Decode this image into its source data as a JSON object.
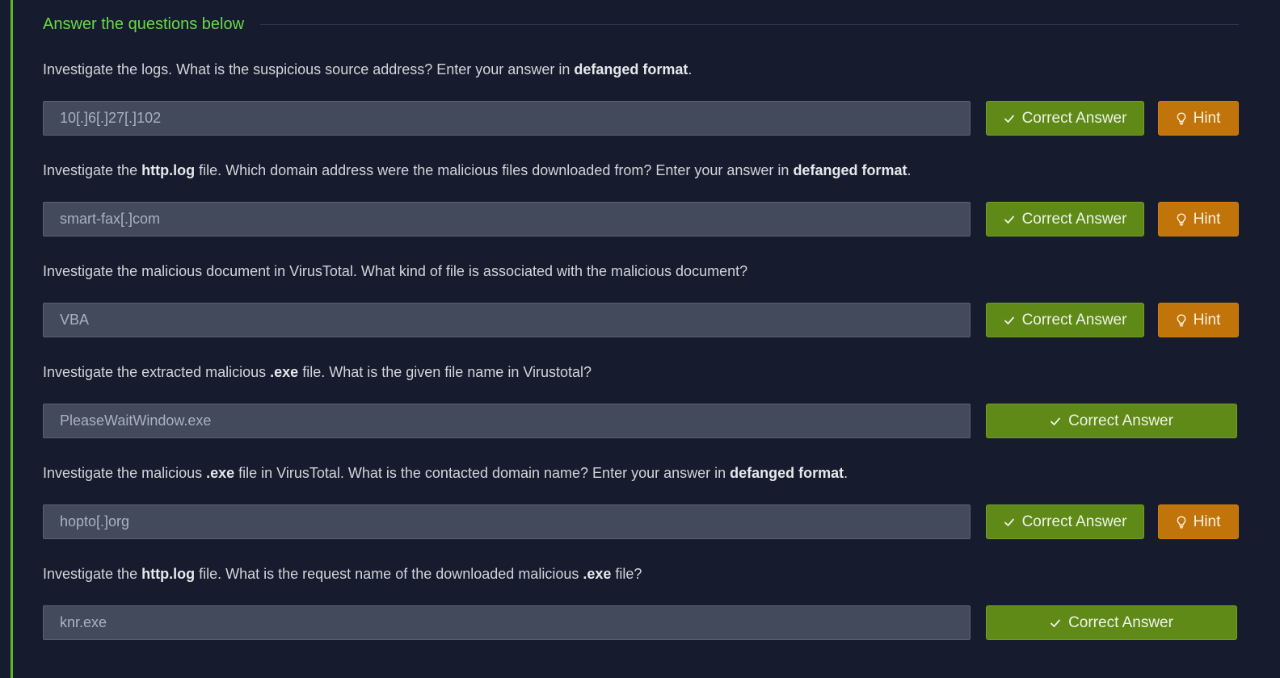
{
  "section": {
    "title": "Answer the questions below"
  },
  "questions": [
    {
      "parts": [
        {
          "text": "Investigate the logs. What is the suspicious source address? Enter your answer in ",
          "bold": false
        },
        {
          "text": "defanged format",
          "bold": true
        },
        {
          "text": ".",
          "bold": false
        }
      ],
      "answer": "10[.]6[.]27[.]102",
      "correct_label": "Correct Answer",
      "hint_label": "Hint"
    },
    {
      "parts": [
        {
          "text": "Investigate the ",
          "bold": false
        },
        {
          "text": "http.log",
          "bold": true
        },
        {
          "text": " file. Which domain address were the malicious files downloaded from? Enter your answer in ",
          "bold": false
        },
        {
          "text": "defanged format",
          "bold": true
        },
        {
          "text": ".",
          "bold": false
        }
      ],
      "answer": "smart-fax[.]com",
      "correct_label": "Correct Answer",
      "hint_label": "Hint"
    },
    {
      "parts": [
        {
          "text": "Investigate the malicious document in VirusTotal. What kind of file is associated with the malicious document?",
          "bold": false
        }
      ],
      "answer": "VBA",
      "correct_label": "Correct Answer",
      "hint_label": "Hint"
    },
    {
      "parts": [
        {
          "text": "Investigate the extracted malicious ",
          "bold": false
        },
        {
          "text": ".exe",
          "bold": true
        },
        {
          "text": " file. What is the given file name in Virustotal?",
          "bold": false
        }
      ],
      "answer": "PleaseWaitWindow.exe",
      "correct_label": "Correct Answer",
      "hint_label": ""
    },
    {
      "parts": [
        {
          "text": "Investigate the malicious ",
          "bold": false
        },
        {
          "text": ".exe",
          "bold": true
        },
        {
          "text": " file in VirusTotal. What is the contacted domain name? Enter your answer in ",
          "bold": false
        },
        {
          "text": "defanged format",
          "bold": true
        },
        {
          "text": ".",
          "bold": false
        }
      ],
      "answer": "hopto[.]org",
      "correct_label": "Correct Answer",
      "hint_label": "Hint"
    },
    {
      "parts": [
        {
          "text": "Investigate the ",
          "bold": false
        },
        {
          "text": "http.log",
          "bold": true
        },
        {
          "text": " file. What is the request name of the downloaded malicious ",
          "bold": false
        },
        {
          "text": ".exe",
          "bold": true
        },
        {
          "text": " file?",
          "bold": false
        }
      ],
      "answer": "knr.exe",
      "correct_label": "Correct Answer",
      "hint_label": ""
    }
  ],
  "colors": {
    "background": "#161c2d",
    "accent": "#5fb829",
    "title": "#6ad84a",
    "correct_button": "#5f8a17",
    "hint_button": "#c07409",
    "input_background": "#434a5b"
  },
  "icons": {
    "correct": "check-icon",
    "hint": "lightbulb-icon"
  }
}
